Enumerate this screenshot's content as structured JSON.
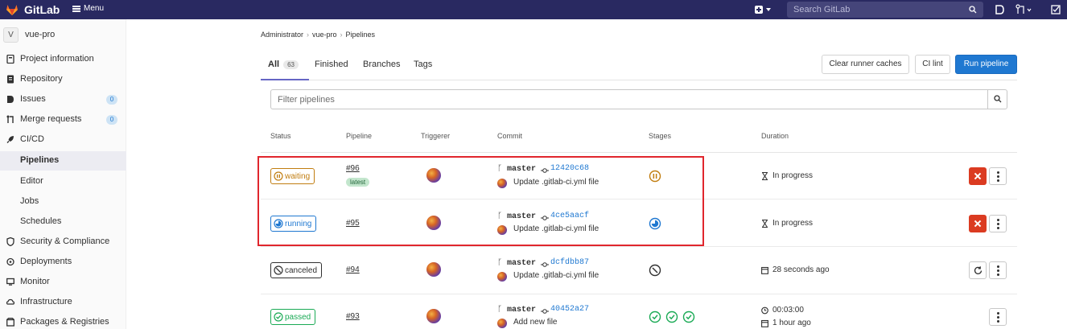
{
  "topbar": {
    "brand": "GitLab",
    "menu_label": "Menu",
    "search_placeholder": "Search GitLab"
  },
  "sidebar": {
    "project_initial": "V",
    "project_name": "vue-pro",
    "items": [
      {
        "label": "Project information"
      },
      {
        "label": "Repository"
      },
      {
        "label": "Issues",
        "badge": "0"
      },
      {
        "label": "Merge requests",
        "badge": "0"
      },
      {
        "label": "CI/CD"
      }
    ],
    "cicd_sub": [
      {
        "label": "Pipelines",
        "active": true
      },
      {
        "label": "Editor"
      },
      {
        "label": "Jobs"
      },
      {
        "label": "Schedules"
      }
    ],
    "items_after": [
      {
        "label": "Security & Compliance"
      },
      {
        "label": "Deployments"
      },
      {
        "label": "Monitor"
      },
      {
        "label": "Infrastructure"
      },
      {
        "label": "Packages & Registries"
      }
    ]
  },
  "breadcrumb": [
    "Administrator",
    "vue-pro",
    "Pipelines"
  ],
  "tabs": [
    {
      "label": "All",
      "count": "63",
      "active": true
    },
    {
      "label": "Finished"
    },
    {
      "label": "Branches"
    },
    {
      "label": "Tags"
    }
  ],
  "buttons": {
    "clear_caches": "Clear runner caches",
    "ci_lint": "CI lint",
    "run_pipeline": "Run pipeline"
  },
  "filter_placeholder": "Filter pipelines",
  "table": {
    "headers": [
      "Status",
      "Pipeline",
      "Triggerer",
      "Commit",
      "Stages",
      "Duration"
    ],
    "rows": [
      {
        "status": "waiting",
        "pipeline": "#96",
        "tag": "latest",
        "branch": "master",
        "sha": "12420c68",
        "message": "Update .gitlab-ci.yml file",
        "duration": "In progress"
      },
      {
        "status": "running",
        "pipeline": "#95",
        "branch": "master",
        "sha": "4ce5aacf",
        "message": "Update .gitlab-ci.yml file",
        "duration": "In progress"
      },
      {
        "status": "canceled",
        "pipeline": "#94",
        "branch": "master",
        "sha": "dcfdbb87",
        "message": "Update .gitlab-ci.yml file",
        "duration": "28 seconds ago"
      },
      {
        "status": "passed",
        "pipeline": "#93",
        "branch": "master",
        "sha": "40452a27",
        "message": "Add new file",
        "duration": "00:03:00",
        "finished": "1 hour ago"
      }
    ]
  },
  "colors": {
    "topbar": "#292961",
    "primary": "#1f78d1",
    "danger": "#db3b21",
    "waiting": "#c17d10",
    "passed": "#1aaa55",
    "highlight": "#e0262d"
  }
}
